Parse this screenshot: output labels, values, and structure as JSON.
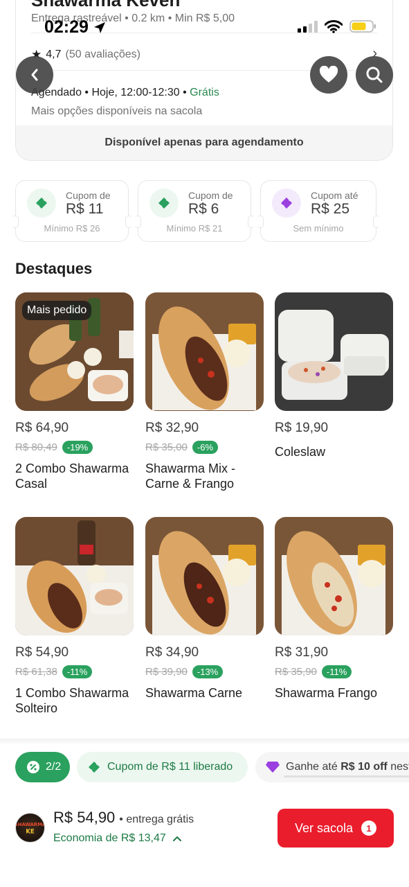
{
  "status_bar": {
    "time": "02:29"
  },
  "store": {
    "name": "Shawarma Keven",
    "meta": "Entrega rastreável • 0.2 km • Min R$ 5,00",
    "rating": "4,7",
    "rating_count": "(50 avaliações)",
    "schedule": "Agendado  •  Hoje, 12:00-12:30  •",
    "schedule_free": "Grátis",
    "schedule_sub": "Mais opções disponíveis na sacola",
    "notice": "Disponível apenas para agendamento"
  },
  "coupons": [
    {
      "label": "Cupom de",
      "value": "R$ 11",
      "minimum": "Mínimo R$ 26",
      "icon": "ticket-icon",
      "color": "#2aa15e",
      "bg": "#ecf7f0"
    },
    {
      "label": "Cupom de",
      "value": "R$ 6",
      "minimum": "Mínimo R$ 21",
      "icon": "ticket-icon",
      "color": "#2aa15e",
      "bg": "#ecf7f0"
    },
    {
      "label": "Cupom até",
      "value": "R$ 25",
      "minimum": "Sem mínimo",
      "icon": "ticket-icon",
      "color": "#9b3fe0",
      "bg": "#f3eafc"
    }
  ],
  "section_title": "Destaques",
  "products": [
    {
      "badge": "Mais pedido",
      "price": "R$ 64,90",
      "old_price": "R$ 80,49",
      "discount": "-19%",
      "name": "2 Combo Shawarma Casal"
    },
    {
      "badge": "",
      "price": "R$ 32,90",
      "old_price": "R$ 35,00",
      "discount": "-6%",
      "name": "Shawarma Mix - Carne & Frango"
    },
    {
      "badge": "",
      "price": "R$ 19,90",
      "old_price": "",
      "discount": "",
      "name": "Coleslaw"
    },
    {
      "badge": "",
      "price": "R$ 54,90",
      "old_price": "R$ 61,38",
      "discount": "-11%",
      "name": "1 Combo Shawarma Solteiro"
    },
    {
      "badge": "",
      "price": "R$ 34,90",
      "old_price": "R$ 39,90",
      "discount": "-13%",
      "name": "Shawarma Carne"
    },
    {
      "badge": "",
      "price": "R$ 31,90",
      "old_price": "R$ 35,90",
      "discount": "-11%",
      "name": "Shawarma Frango"
    }
  ],
  "promo_pills": {
    "progress": "2/2",
    "coupon_unlocked": "Cupom de R$ 11 liberado",
    "earn_prefix": "Ganhe até",
    "earn_amount": "R$ 10 off",
    "earn_suffix": "nest"
  },
  "cart": {
    "logo_text": "SHAWARMA KE",
    "total": "R$ 54,90",
    "delivery": "• entrega grátis",
    "savings": "Economia de R$ 13,47",
    "button_label": "Ver sacola",
    "item_count": "1"
  },
  "colors": {
    "accent_red": "#ea1d2c",
    "green": "#2aa15e",
    "purple": "#9b3fe0"
  }
}
